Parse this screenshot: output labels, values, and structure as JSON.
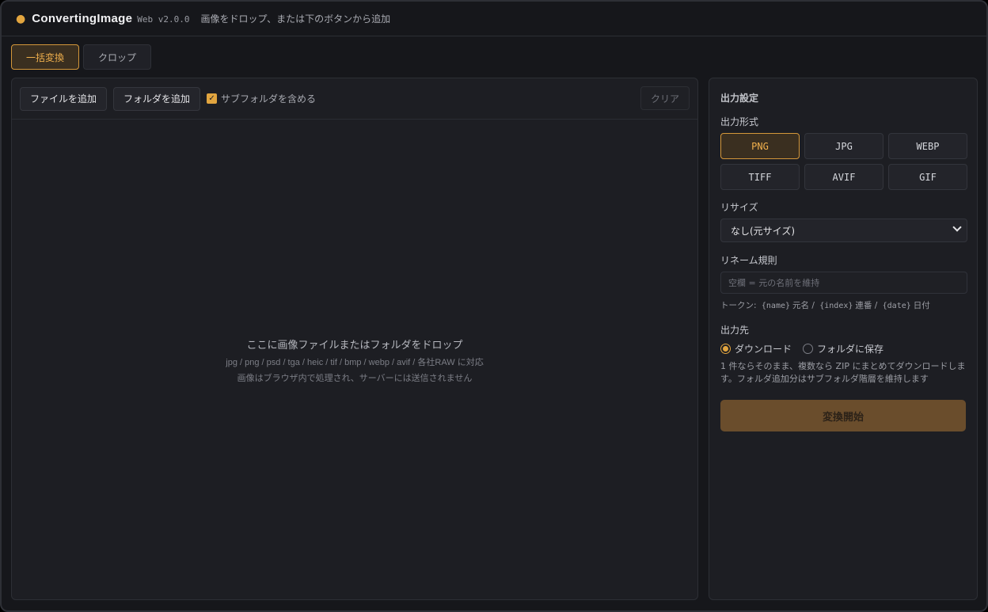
{
  "header": {
    "app_name": "ConvertingImage",
    "version": "Web v2.0.0",
    "subtitle": "画像をドロップ、または下のボタンから追加",
    "accent_color": "#e2a53f"
  },
  "tabs": [
    {
      "label": "一括変換",
      "active": true
    },
    {
      "label": "クロップ",
      "active": false
    }
  ],
  "toolbar": {
    "add_files": "ファイルを追加",
    "add_folder": "フォルダを追加",
    "include_subfolders": "サブフォルダを含める",
    "include_subfolders_checked": true,
    "clear": "クリア"
  },
  "dropzone": {
    "main": "ここに画像ファイルまたはフォルダをドロップ",
    "formats": "jpg / png / psd / tga / heic / tif / bmp / webp / avif / 各社RAW に対応",
    "note": "画像はブラウザ内で処理され、サーバーには送信されません"
  },
  "settings": {
    "heading": "出力設定",
    "format_label": "出力形式",
    "formats": [
      "PNG",
      "JPG",
      "WEBP",
      "TIFF",
      "AVIF",
      "GIF"
    ],
    "selected_format": "PNG",
    "resize_label": "リサイズ",
    "resize_value": "なし(元サイズ)",
    "rename_label": "リネーム規則",
    "rename_placeholder": "空欄 = 元の名前を維持",
    "tokens_prefix": "トークン:",
    "token_name": "{name}",
    "token_name_desc": "元名 /",
    "token_index": "{index}",
    "token_index_desc": "連番 /",
    "token_date": "{date}",
    "token_date_desc": "日付",
    "dest_label": "出力先",
    "dest_download": "ダウンロード",
    "dest_folder": "フォルダに保存",
    "dest_selected": "ダウンロード",
    "dest_desc": "1 件ならそのまま、複数なら ZIP にまとめてダウンロードします。フォルダ追加分はサブフォルダ階層を維持します",
    "start_button": "変換開始"
  }
}
